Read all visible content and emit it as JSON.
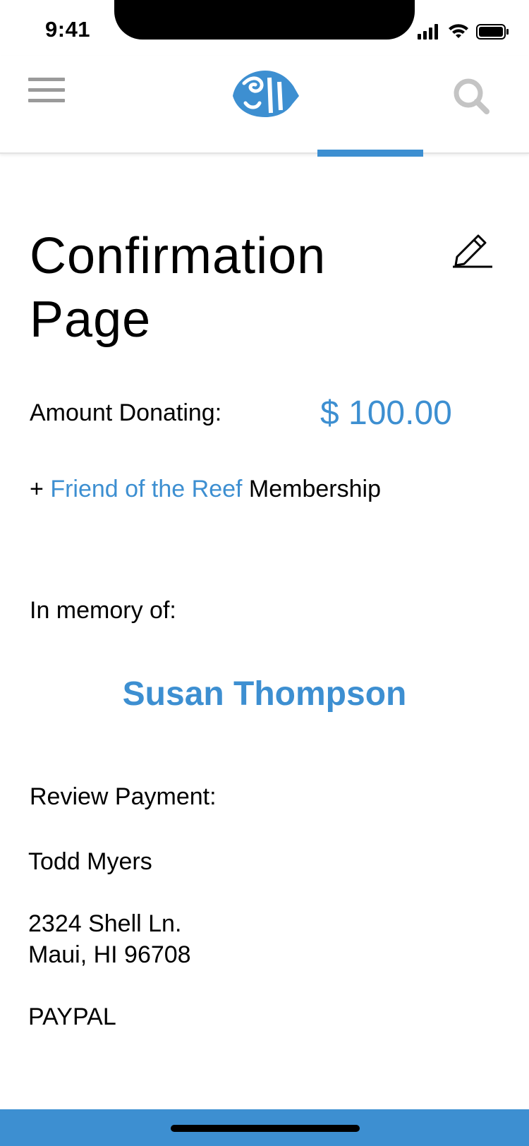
{
  "status_bar": {
    "time": "9:41"
  },
  "nav": {
    "menu_icon": "hamburger-icon",
    "logo_icon": "fish-logo-icon",
    "search_icon": "search-icon",
    "accent_color": "#3d8fd1"
  },
  "page": {
    "title": "Confirmation Page",
    "edit_icon": "pencil-icon"
  },
  "donation": {
    "amount_label": "Amount Donating:",
    "amount_value": "$ 100.00",
    "membership_prefix": "+ ",
    "membership_name": "Friend of the Reef",
    "membership_suffix": " Membership"
  },
  "memorial": {
    "label": "In memory of:",
    "name": "Susan Thompson"
  },
  "payment": {
    "label": "Review Payment:",
    "name": "Todd Myers",
    "address_line1": "2324 Shell Ln.",
    "address_line2": "Maui, HI 96708",
    "method": "PAYPAL"
  }
}
